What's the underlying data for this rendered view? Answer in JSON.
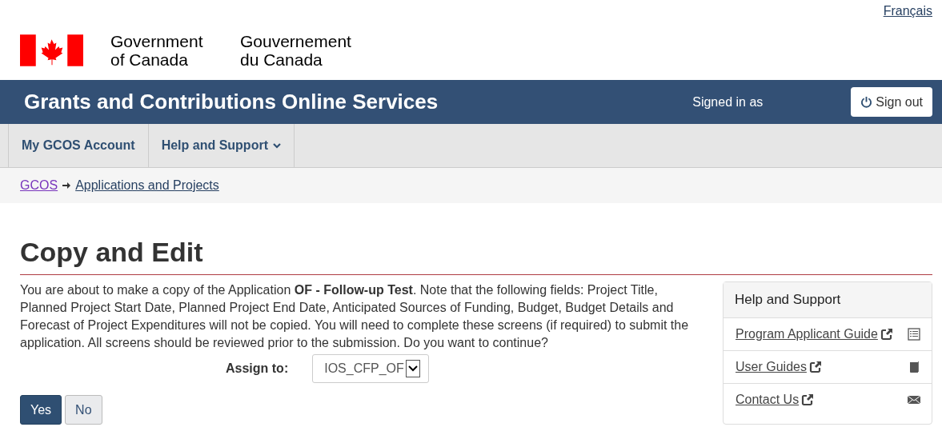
{
  "language_link": "Français",
  "signature": {
    "english": [
      "Government",
      "of Canada"
    ],
    "french": [
      "Gouvernement",
      "du Canada"
    ]
  },
  "app_bar": {
    "title": "Grants and Contributions Online Services",
    "signed_in": "Signed in as",
    "sign_out": "Sign out"
  },
  "menu": [
    {
      "label": "My GCOS Account",
      "dropdown": false
    },
    {
      "label": "Help and Support",
      "dropdown": true
    }
  ],
  "breadcrumb": [
    {
      "label": "GCOS",
      "visited": true
    },
    {
      "label": "Applications and Projects",
      "visited": false
    }
  ],
  "heading": "Copy and Edit",
  "message": "You are about to make a copy of the Application **OF - Follow-up Test**. Note that the following fields: Project Title, Planned Project Start Date, Planned Project End Date, Anticipated Sources of Funding, Budget, Budget Details and Forecast of Project Expenditures will not be copied. You will need to complete these screens (if required) to submit the application. All screens should be reviewed prior to the submission. Do you want to continue?",
  "assign": {
    "label": "Assign to:",
    "value": "IOS_CFP_OF"
  },
  "buttons": [
    {
      "label": "Yes",
      "primary": true
    },
    {
      "label": "No",
      "primary": false
    }
  ],
  "help_panel": {
    "title": "Help and Support",
    "links": [
      {
        "label": "Program Applicant Guide",
        "kind": "list"
      },
      {
        "label": "User Guides",
        "kind": "book"
      },
      {
        "label": "Contact Us",
        "kind": "mail"
      }
    ]
  }
}
